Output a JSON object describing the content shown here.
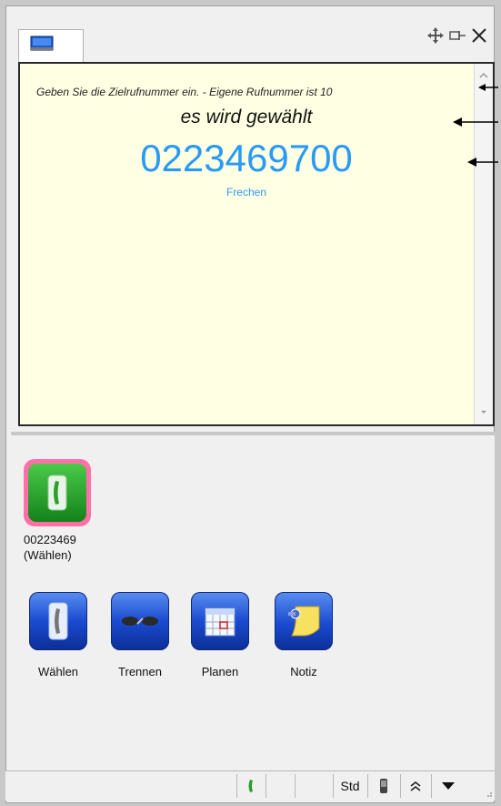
{
  "display": {
    "hint": "Geben Sie die Zielrufnummer ein. - Eigene Rufnummer ist 10",
    "status": "es wird gewählt",
    "number": "0223469700",
    "provider": "Frechen"
  },
  "dial_tile": {
    "line1": "00223469",
    "line2": "(Wählen)"
  },
  "actions": [
    {
      "label": "Wählen",
      "icon": "phone-icon"
    },
    {
      "label": "Trennen",
      "icon": "disconnect-icon"
    },
    {
      "label": "Planen",
      "icon": "calendar-icon"
    },
    {
      "label": "Notiz",
      "icon": "note-icon"
    }
  ],
  "statusbar": {
    "mode": "Std"
  },
  "colors": {
    "display_bg": "#ffffe4",
    "number_blue": "#2a9af4",
    "dial_green": "#2aa02a",
    "highlight_pink": "#ff6fa8",
    "action_blue": "#1a4bd0"
  }
}
